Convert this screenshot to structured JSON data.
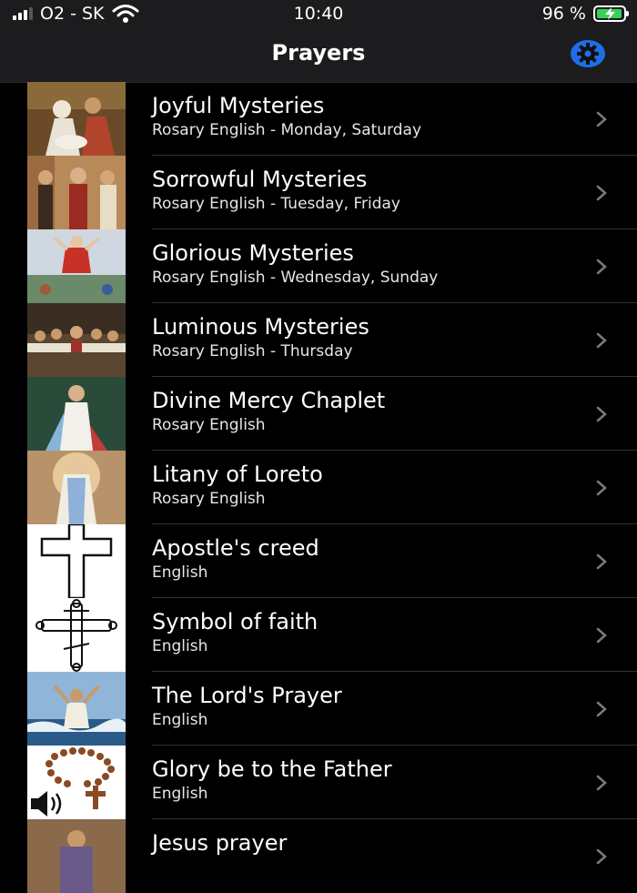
{
  "status": {
    "carrier": "O2 - SK",
    "time": "10:40",
    "battery": "96 %"
  },
  "nav": {
    "title": "Prayers"
  },
  "colors": {
    "accent": "#1e6ee8",
    "battery": "#36d157",
    "background": "#000000"
  },
  "items": [
    {
      "title": "Joyful Mysteries",
      "subtitle": "Rosary English - Monday, Saturday",
      "icon": "nativity-image"
    },
    {
      "title": "Sorrowful Mysteries",
      "subtitle": "Rosary English - Tuesday, Friday",
      "icon": "passion-image"
    },
    {
      "title": "Glorious Mysteries",
      "subtitle": "Rosary English - Wednesday, Sunday",
      "icon": "ascension-image"
    },
    {
      "title": "Luminous Mysteries",
      "subtitle": "Rosary English - Thursday",
      "icon": "last-supper-image"
    },
    {
      "title": "Divine Mercy Chaplet",
      "subtitle": "Rosary English",
      "icon": "divine-mercy-image"
    },
    {
      "title": "Litany of Loreto",
      "subtitle": "Rosary English",
      "icon": "virgin-mary-image"
    },
    {
      "title": "Apostle's creed",
      "subtitle": "English",
      "icon": "cross-image"
    },
    {
      "title": "Symbol of faith",
      "subtitle": "English",
      "icon": "orthodox-cross-image"
    },
    {
      "title": "The Lord's Prayer",
      "subtitle": "English",
      "icon": "jesus-sea-image"
    },
    {
      "title": "Glory be to the Father",
      "subtitle": "English",
      "icon": "rosary-speaker-image"
    },
    {
      "title": "Jesus prayer",
      "subtitle": "",
      "icon": "jesus-image"
    }
  ]
}
